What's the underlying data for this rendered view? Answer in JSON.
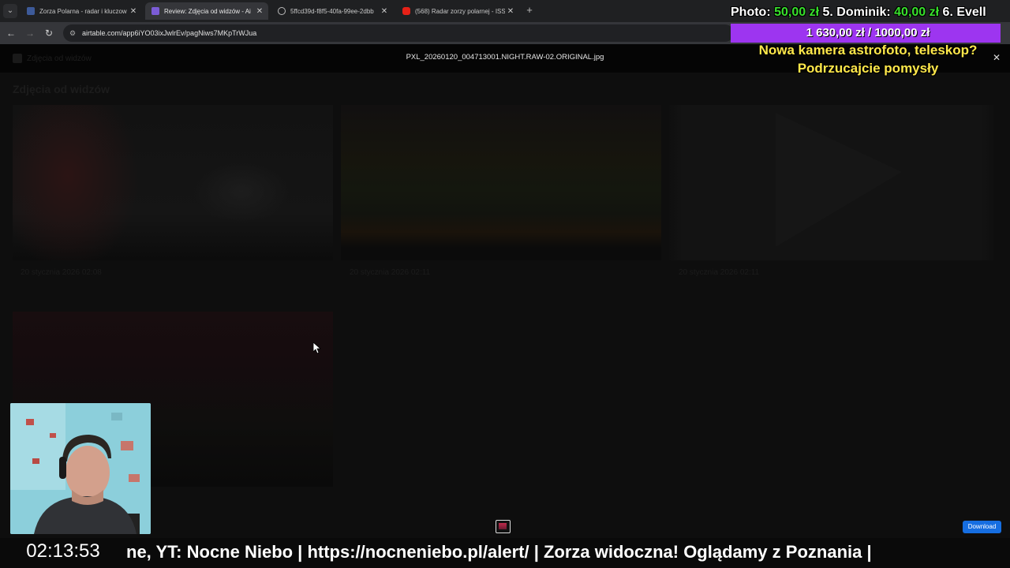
{
  "browser": {
    "tabs": [
      {
        "title": "Zorza Polarna - radar i kluczow",
        "favicon": "airtable-icon",
        "active": false
      },
      {
        "title": "Review: Zdjęcia od widzów - Ai",
        "favicon": "airtable-icon",
        "active": true
      },
      {
        "title": "5ffcd39d-f8f5-40fa-99ee-2dbb",
        "favicon": "globe-icon",
        "active": false
      },
      {
        "title": "(568) Radar zorzy polarnej - ISS",
        "favicon": "youtube-icon",
        "active": false
      }
    ],
    "url": "airtable.com/app6iYO03ixJwlrEv/pagNiws7MKpTrWJua"
  },
  "viewer": {
    "file_name": "PXL_20260120_004713001.NIGHT.RAW-02.ORIGINAL.jpg",
    "download_label": "Download"
  },
  "gallery": {
    "app_title": "Zdjęcia od widzów",
    "title": "Zdjęcia od widzów",
    "cards": [
      {
        "date": "20 stycznia 2026 02:08"
      },
      {
        "date": "20 stycznia 2026 02:11"
      },
      {
        "date": "20 stycznia 2026 02:11"
      },
      {
        "date": ""
      }
    ]
  },
  "overlay": {
    "donation_line": {
      "prefix": "Photo: ",
      "amount1": "50,00 zł",
      "mid": " 5. Dominik: ",
      "amount2": "40,00 zł",
      "suffix": " 6. Evell"
    },
    "goal_amount": "1 630,00 zł / 1000,00 zł",
    "goal_progress": 1.0,
    "goal_text_1": "Nowa kamera astrofoto, teleskop?",
    "goal_text_2": "Podrzucajcie pomysły",
    "clock": "02:13:53",
    "ticker": "ne, YT: Nocne Niebo  |  https://nocneniebo.pl/alert/  |  Zorza widoczna! Oglądamy z Poznania |"
  },
  "colors": {
    "accent_green": "#38e02c",
    "goal_purple": "#8a2be2",
    "goal_yellow": "#ffe84a",
    "download_blue": "#166ee1"
  }
}
